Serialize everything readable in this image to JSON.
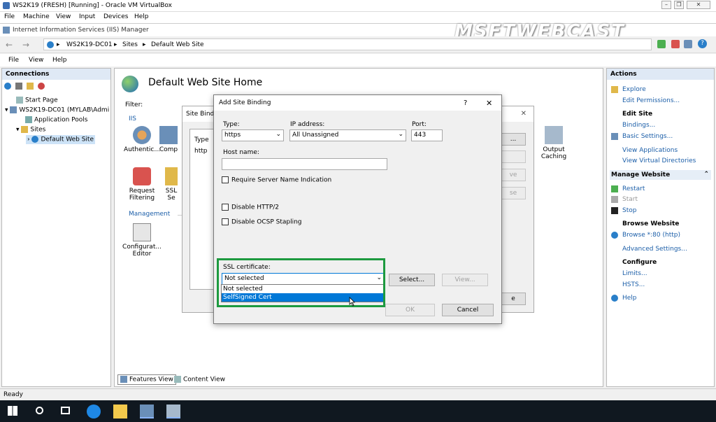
{
  "vbox": {
    "title": "WS2K19 (FRESH) [Running] - Oracle VM VirtualBox",
    "menu": [
      "File",
      "Machine",
      "View",
      "Input",
      "Devices",
      "Help"
    ]
  },
  "iis": {
    "title": "Internet Information Services (IIS) Manager",
    "breadcrumb": [
      "WS2K19-DC01",
      "Sites",
      "Default Web Site"
    ],
    "menu": [
      "File",
      "View",
      "Help"
    ],
    "watermark": "MSFTWEBCAST"
  },
  "connections": {
    "header": "Connections",
    "tree": [
      "Start Page",
      "WS2K19-DC01 (MYLAB\\Admi",
      "Application Pools",
      "Sites",
      "Default Web Site"
    ]
  },
  "main": {
    "title": "Default Web Site Home",
    "filter_label": "Filter:",
    "group_iis": "IIS",
    "group_management": "Management",
    "features": {
      "authentication": "Authentic...",
      "compression": "Comp",
      "output_caching_1": "Output",
      "output_caching_2": "Caching",
      "request_filtering_1": "Request",
      "request_filtering_2": "Filtering",
      "ssl": "SSL Se",
      "config_editor_1": "Configurat...",
      "config_editor_2": "Editor"
    },
    "view_tabs": [
      "Features View",
      "Content View"
    ]
  },
  "site_bindings": {
    "title": "Site Bindin",
    "col_type": "Type",
    "row_type": "http"
  },
  "add_binding": {
    "title": "Add Site Binding",
    "help": "?",
    "close": "✕",
    "type_label": "Type:",
    "type_value": "https",
    "ip_label": "IP address:",
    "ip_value": "All Unassigned",
    "port_label": "Port:",
    "port_value": "443",
    "host_label": "Host name:",
    "host_value": "",
    "sni_label": "Require Server Name Indication",
    "http2_label": "Disable HTTP/2",
    "ocsp_label": "Disable OCSP Stapling",
    "ssl_label": "SSL certificate:",
    "ssl_value": "Not selected",
    "ssl_options": [
      "Not selected",
      "SelfSigned Cert"
    ],
    "select_btn": "Select...",
    "view_btn": "View...",
    "ok_btn": "OK",
    "cancel_btn": "Cancel"
  },
  "actions": {
    "header": "Actions",
    "explore": "Explore",
    "edit_permissions": "Edit Permissions...",
    "edit_site": "Edit Site",
    "bindings": "Bindings...",
    "basic_settings": "Basic Settings...",
    "view_applications": "View Applications",
    "view_vdirs": "View Virtual Directories",
    "manage_website": "Manage Website",
    "restart": "Restart",
    "start": "Start",
    "stop": "Stop",
    "browse_website": "Browse Website",
    "browse_80": "Browse *:80 (http)",
    "advanced_settings": "Advanced Settings...",
    "configure": "Configure",
    "limits": "Limits...",
    "hsts": "HSTS...",
    "help": "Help"
  },
  "status": {
    "text": "Ready"
  },
  "colors": {
    "highlight": "#1d9a3f",
    "selection": "#0078d7",
    "link": "#1b5ea8"
  }
}
